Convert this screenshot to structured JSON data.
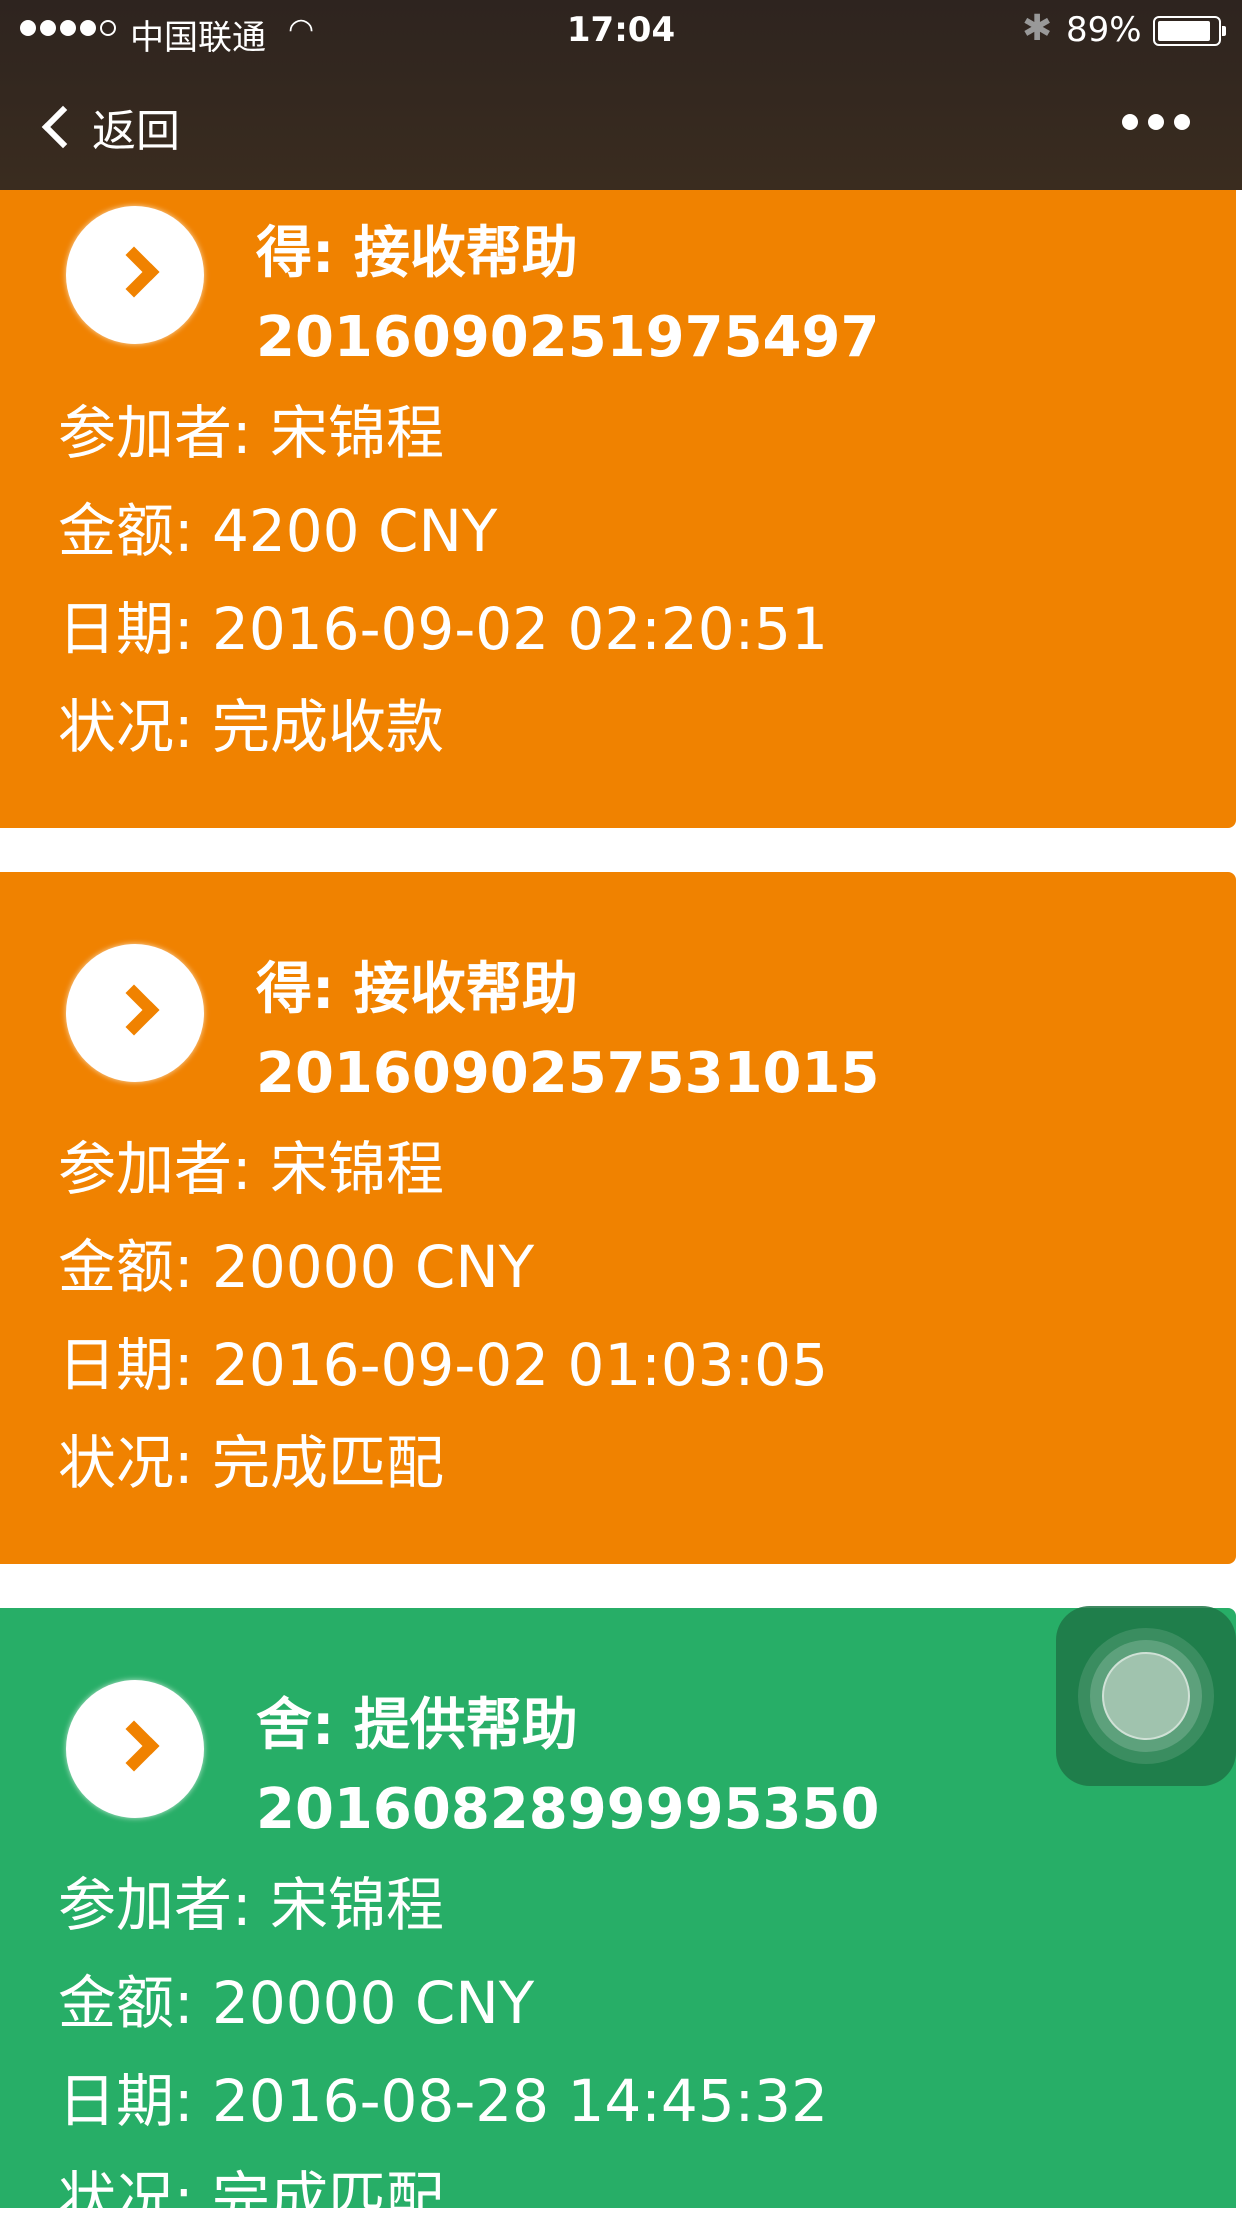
{
  "status_bar": {
    "carrier": "中国联通",
    "time": "17:04",
    "battery": "89%",
    "battery_level": 0.89
  },
  "nav": {
    "back_label": "返回"
  },
  "cards": [
    {
      "color": "#f08200",
      "title": "得: 接收帮助",
      "id": "2016090251975497",
      "participant": "参加者: 宋锦程",
      "amount": "金额: 4200 CNY",
      "date": "日期: 2016-09-02 02:20:51",
      "status": "状况:  完成收款"
    },
    {
      "color": "#f08200",
      "title": "得: 接收帮助",
      "id": "2016090257531015",
      "participant": "参加者: 宋锦程",
      "amount": "金额: 20000 CNY",
      "date": "日期: 2016-09-02 01:03:05",
      "status": "状况:  完成匹配"
    },
    {
      "color": "#27ae67",
      "title": "舍: 提供帮助",
      "id": "2016082899995350",
      "participant": "参加者: 宋锦程",
      "amount": "金额: 20000 CNY",
      "date": "日期: 2016-08-28 14:45:32",
      "status": "状况:  完成匹配"
    }
  ]
}
